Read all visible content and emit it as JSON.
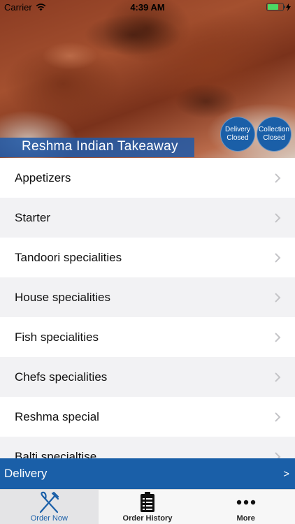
{
  "status_bar": {
    "carrier": "Carrier",
    "time": "4:39 AM",
    "battery_level": 0.7
  },
  "header": {
    "restaurant_name": "Reshma Indian Takeaway",
    "delivery_status": {
      "line1": "Delivery",
      "line2": "Closed"
    },
    "collection_status": {
      "line1": "Collection",
      "line2": "Closed"
    }
  },
  "menu": {
    "categories": [
      {
        "label": "Appetizers"
      },
      {
        "label": "Starter"
      },
      {
        "label": "Tandoori specialities"
      },
      {
        "label": "House specialities"
      },
      {
        "label": "Fish specialities"
      },
      {
        "label": "Chefs specialities"
      },
      {
        "label": "Reshma special"
      },
      {
        "label": "Balti specialtise"
      }
    ]
  },
  "delivery_bar": {
    "label": "Delivery",
    "arrow": ">"
  },
  "tabs": [
    {
      "label": "Order Now",
      "icon": "fork-knife-icon",
      "active": true
    },
    {
      "label": "Order History",
      "icon": "clipboard-list-icon",
      "active": false
    },
    {
      "label": "More",
      "icon": "more-dots-icon",
      "active": false
    }
  ],
  "colors": {
    "brand_blue": "#1a5fa8",
    "battery_green": "#4cd964"
  }
}
